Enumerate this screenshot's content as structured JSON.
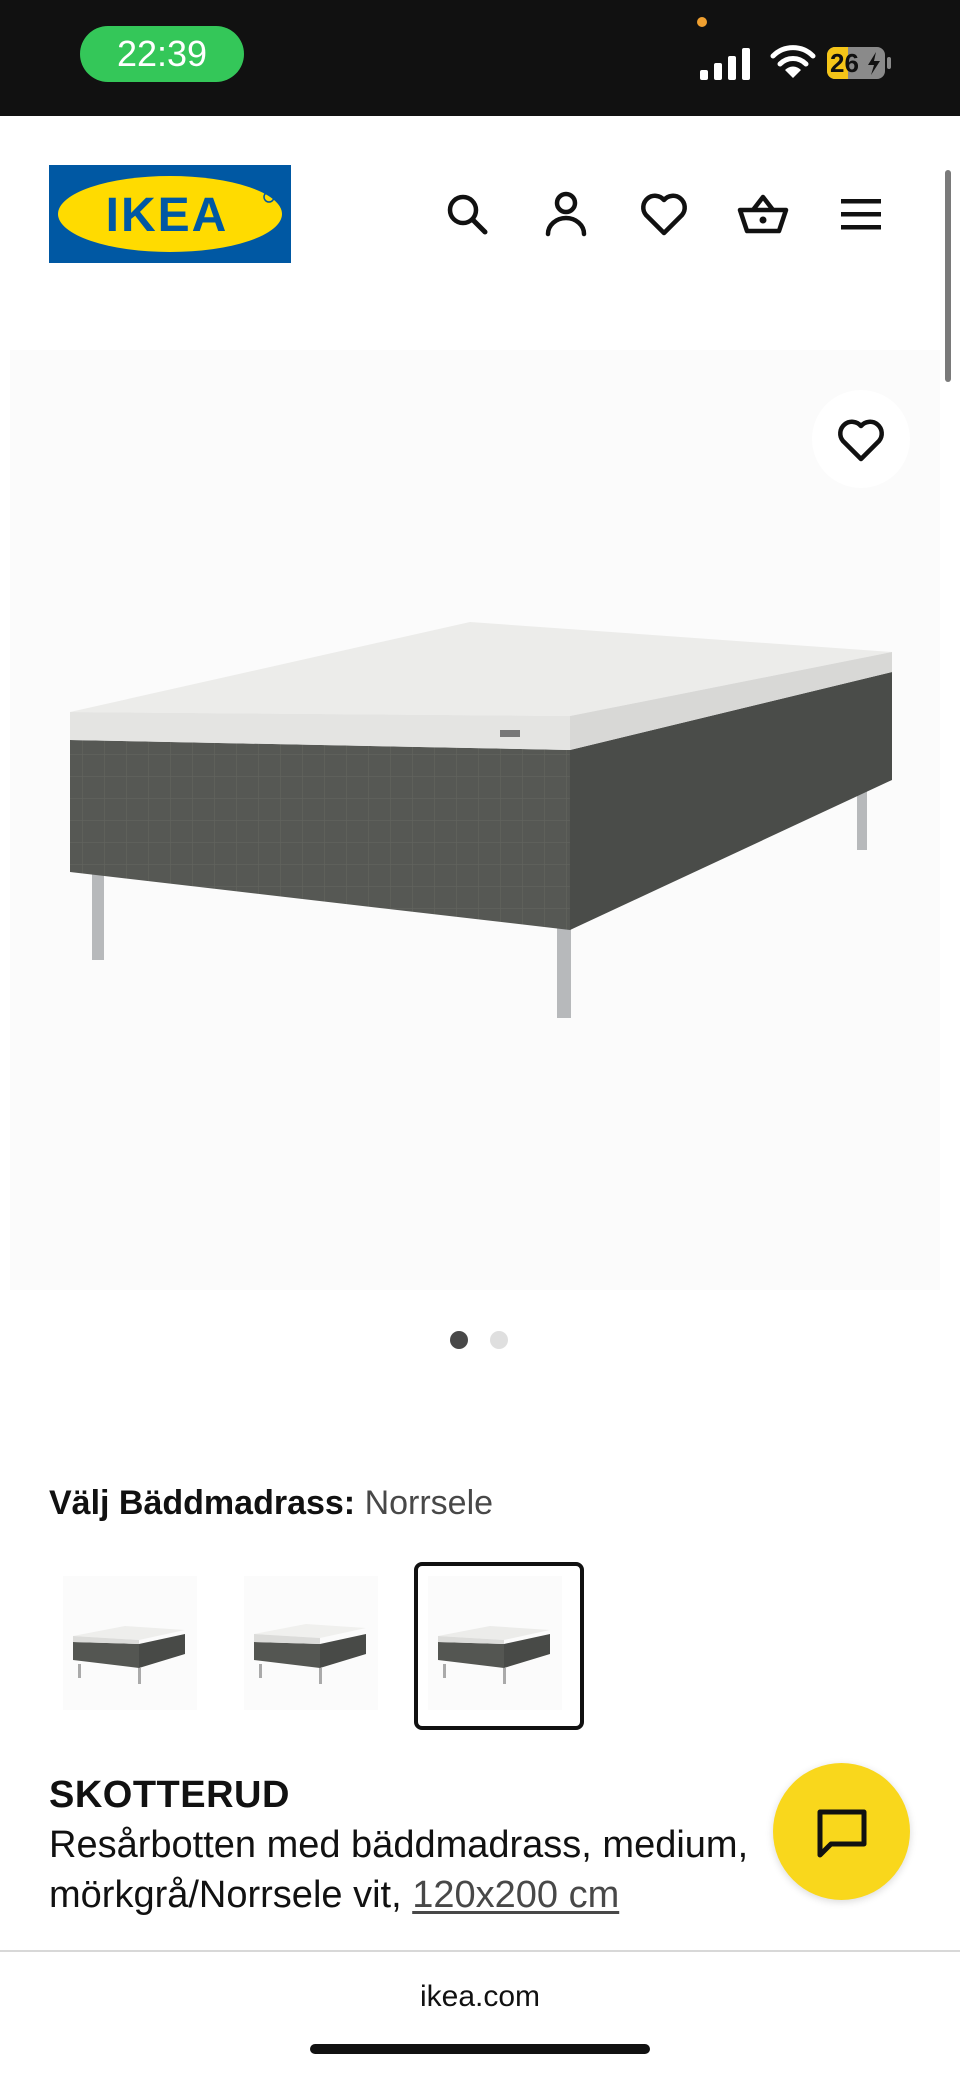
{
  "status_bar": {
    "time": "22:39",
    "battery": "26"
  },
  "header": {
    "logo_text": "IKEA",
    "logo_colors": {
      "blue": "#0058a3",
      "yellow": "#ffdb00"
    },
    "icons": [
      "search-icon",
      "account-icon",
      "heart-icon",
      "basket-icon",
      "menu-icon"
    ]
  },
  "gallery": {
    "wishlist_icon": "heart-icon",
    "pages": 2,
    "active_page": 1
  },
  "variant": {
    "label": "Välj Bäddmadrass:",
    "selected": "Norrsele",
    "option_count": 3,
    "selected_index": 2
  },
  "product": {
    "name": "SKOTTERUD",
    "description": "Resårbotten med bäddmadrass, medium, mörkgrå/Norrsele vit,",
    "size_link": "120x200 cm"
  },
  "chat": {
    "icon": "chat-icon",
    "color": "#f9d71c"
  },
  "browser": {
    "domain": "ikea.com"
  }
}
